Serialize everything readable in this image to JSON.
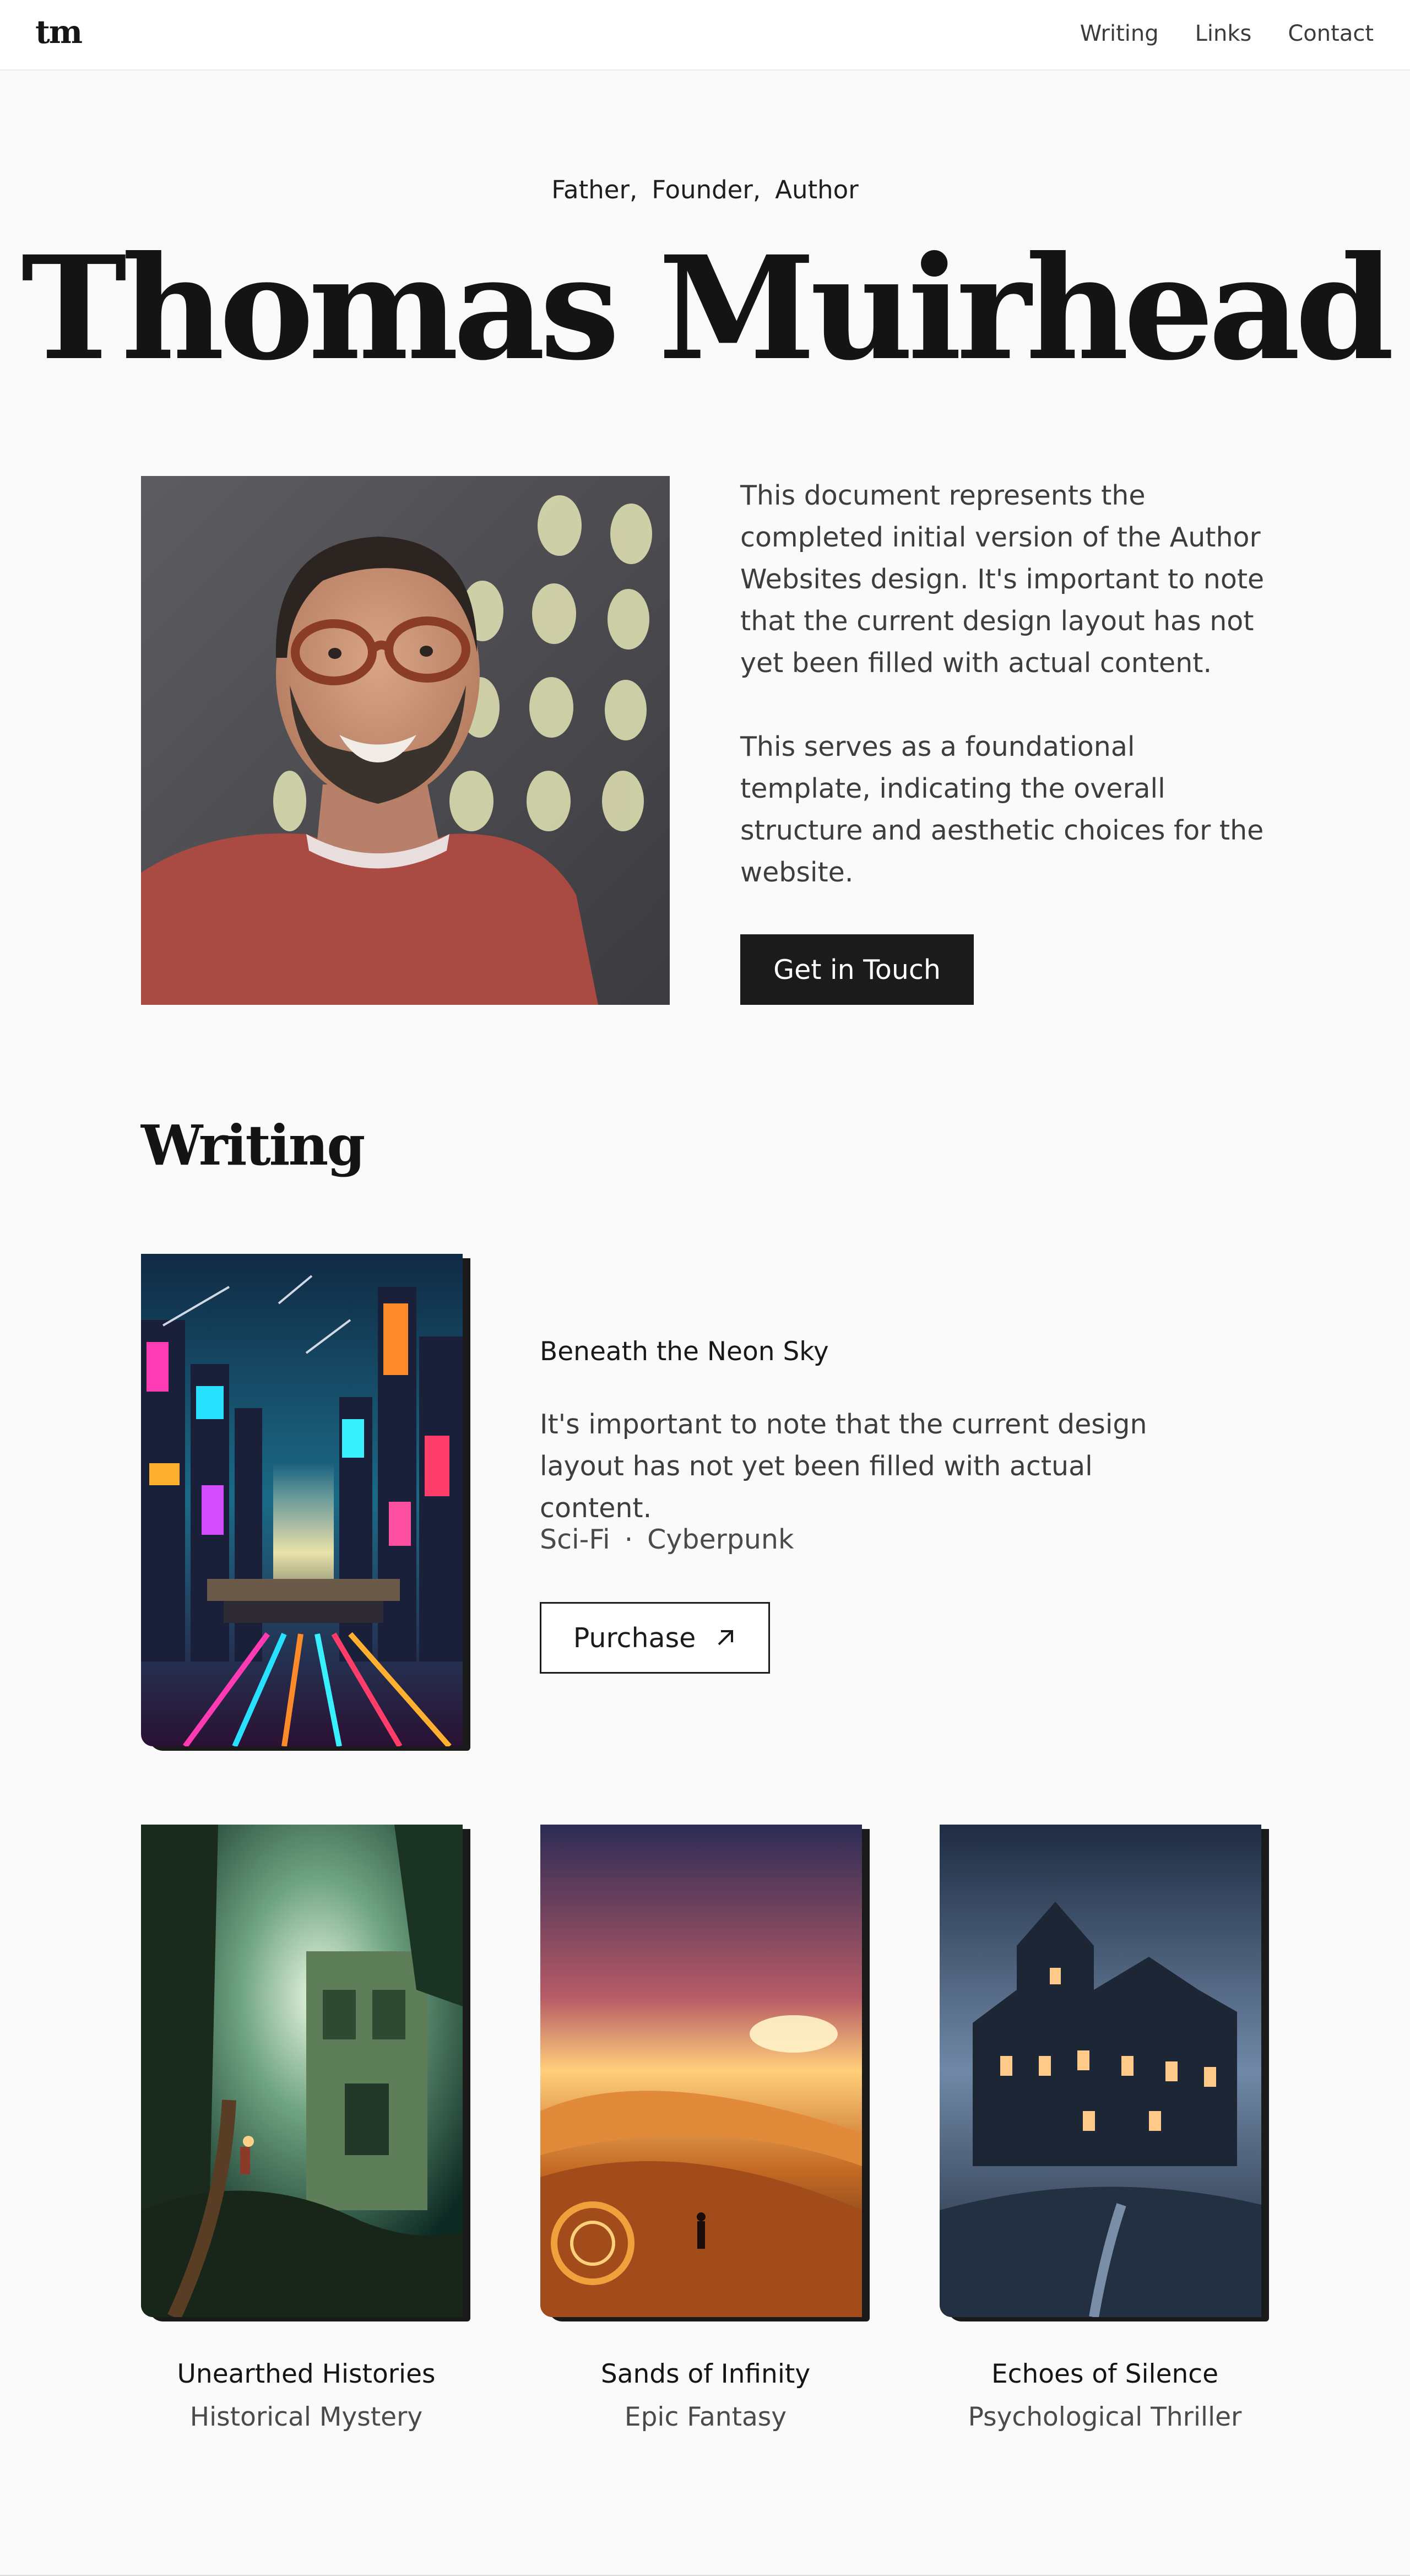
{
  "header": {
    "logo": "tm",
    "nav": [
      "Writing",
      "Links",
      "Contact"
    ]
  },
  "hero": {
    "roles": [
      "Father,",
      "Founder,",
      "Author"
    ],
    "name": "Thomas Muirhead",
    "intro": [
      "This document represents the completed initial version of the Author Websites design. It's important to note that the current design layout has not yet been filled with actual content.",
      "This serves as a foundational template, indicating the overall structure and aesthetic choices for the website."
    ],
    "cta_label": "Get in Touch"
  },
  "writing": {
    "title": "Writing",
    "featured": {
      "title": "Beneath the Neon Sky",
      "description": "It's important to note that the current design layout has not yet been filled with actual content.",
      "tags": [
        "Sci-Fi",
        "Cyberpunk"
      ],
      "tag_separator": "·",
      "purchase_label": "Purchase"
    },
    "books": [
      {
        "title": "Unearthed Histories",
        "genre": "Historical Mystery"
      },
      {
        "title": "Sands of Infinity",
        "genre": "Epic Fantasy"
      },
      {
        "title": "Echoes of Silence",
        "genre": "Psychological Thriller"
      }
    ]
  },
  "icons": {
    "purchase": "arrow-up-right-icon"
  },
  "colors": {
    "background": "#fafafa",
    "text": "#141414",
    "muted": "#3d3d3d",
    "button": "#1b1b1b"
  }
}
